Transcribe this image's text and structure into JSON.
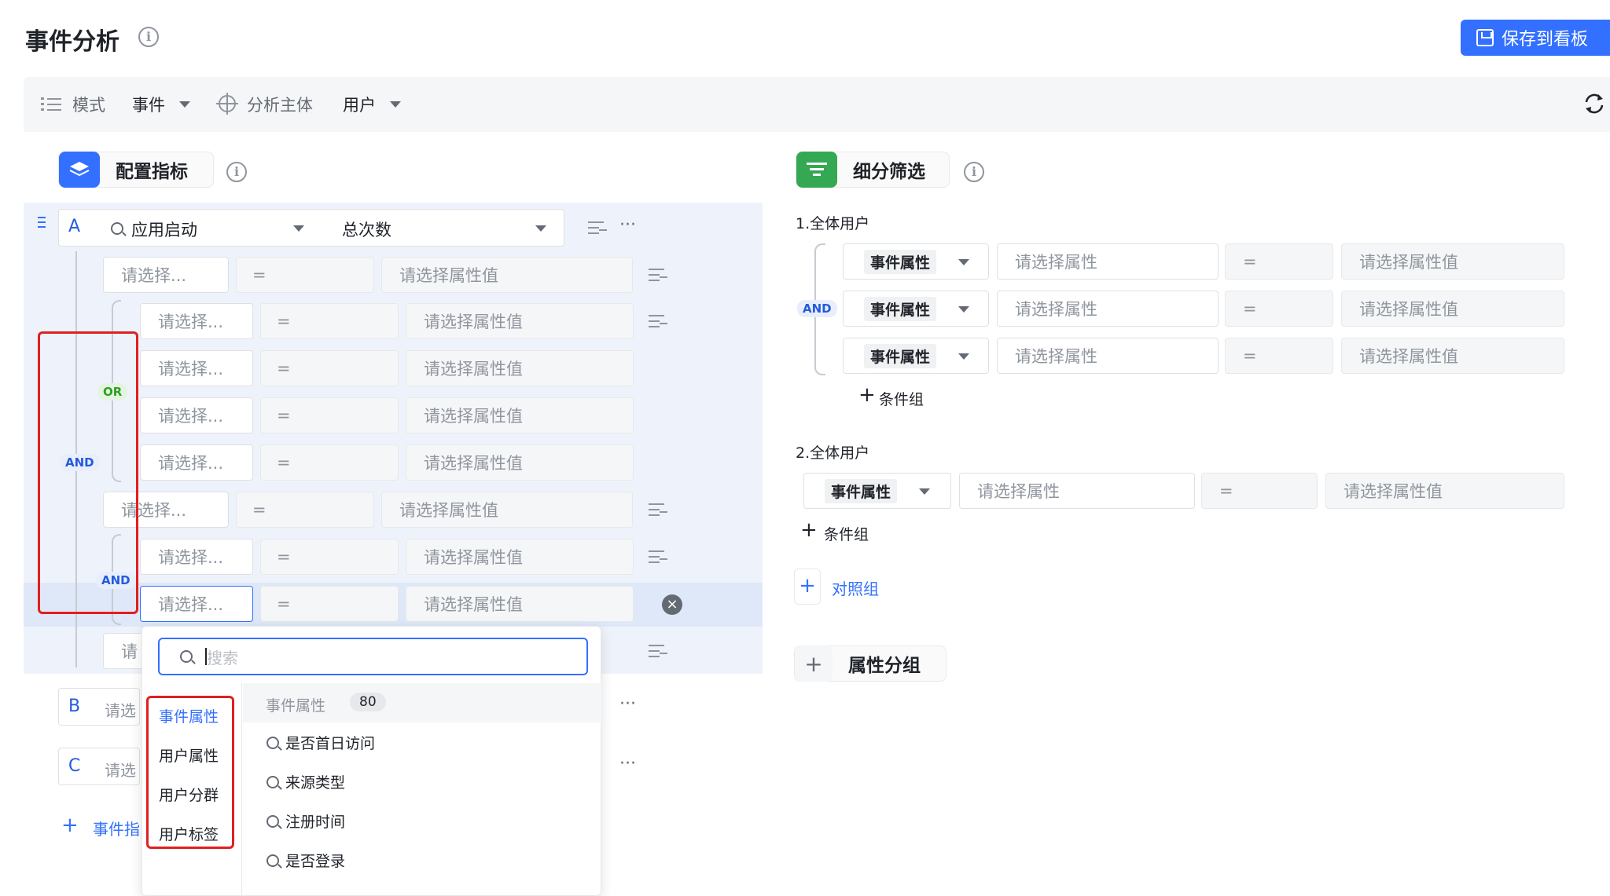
{
  "header": {
    "title": "事件分析",
    "save_label": "保存到看板"
  },
  "toolbar": {
    "mode_label": "模式",
    "mode_value": "事件",
    "subject_label": "分析主体",
    "subject_value": "用户"
  },
  "config": {
    "title": "配置指标",
    "group_a": {
      "letter": "A",
      "event": "应用启动",
      "metric": "总次数"
    },
    "select_placeholder": "请选择...",
    "select_placeholder_cut": "请选择...",
    "operator": "=",
    "value_placeholder": "请选择属性值",
    "group_b_letter": "B",
    "group_c_letter": "C",
    "group_b_placeholder": "请选",
    "group_c_placeholder": "请选",
    "add_metric": "事件指",
    "cut_placeholder": "请",
    "logic": {
      "and_outer": "AND",
      "or_inner": "OR",
      "and_inner": "AND"
    }
  },
  "dropdown": {
    "search_placeholder": "搜索",
    "categories": [
      "事件属性",
      "用户属性",
      "用户分群",
      "用户标签"
    ],
    "active_category": "事件属性",
    "section_label": "事件属性",
    "section_count": "80",
    "items": [
      "是否首日访问",
      "来源类型",
      "注册时间",
      "是否登录"
    ]
  },
  "filter": {
    "title": "细分筛选",
    "group1_title": "1.全体用户",
    "group2_title": "2.全体用户",
    "attr_type": "事件属性",
    "attr_placeholder": "请选择属性",
    "operator": "=",
    "value_placeholder": "请选择属性值",
    "and_label": "AND",
    "add_condition": "条件组",
    "add_compare": "对照组",
    "attr_group": "属性分组"
  },
  "colors": {
    "accent": "#3370ff",
    "and_tag": "#245bdb",
    "or_tag": "#2ea121",
    "highlight": "#e02020",
    "config_icon": "#3370ff",
    "filter_icon": "#34a853"
  }
}
